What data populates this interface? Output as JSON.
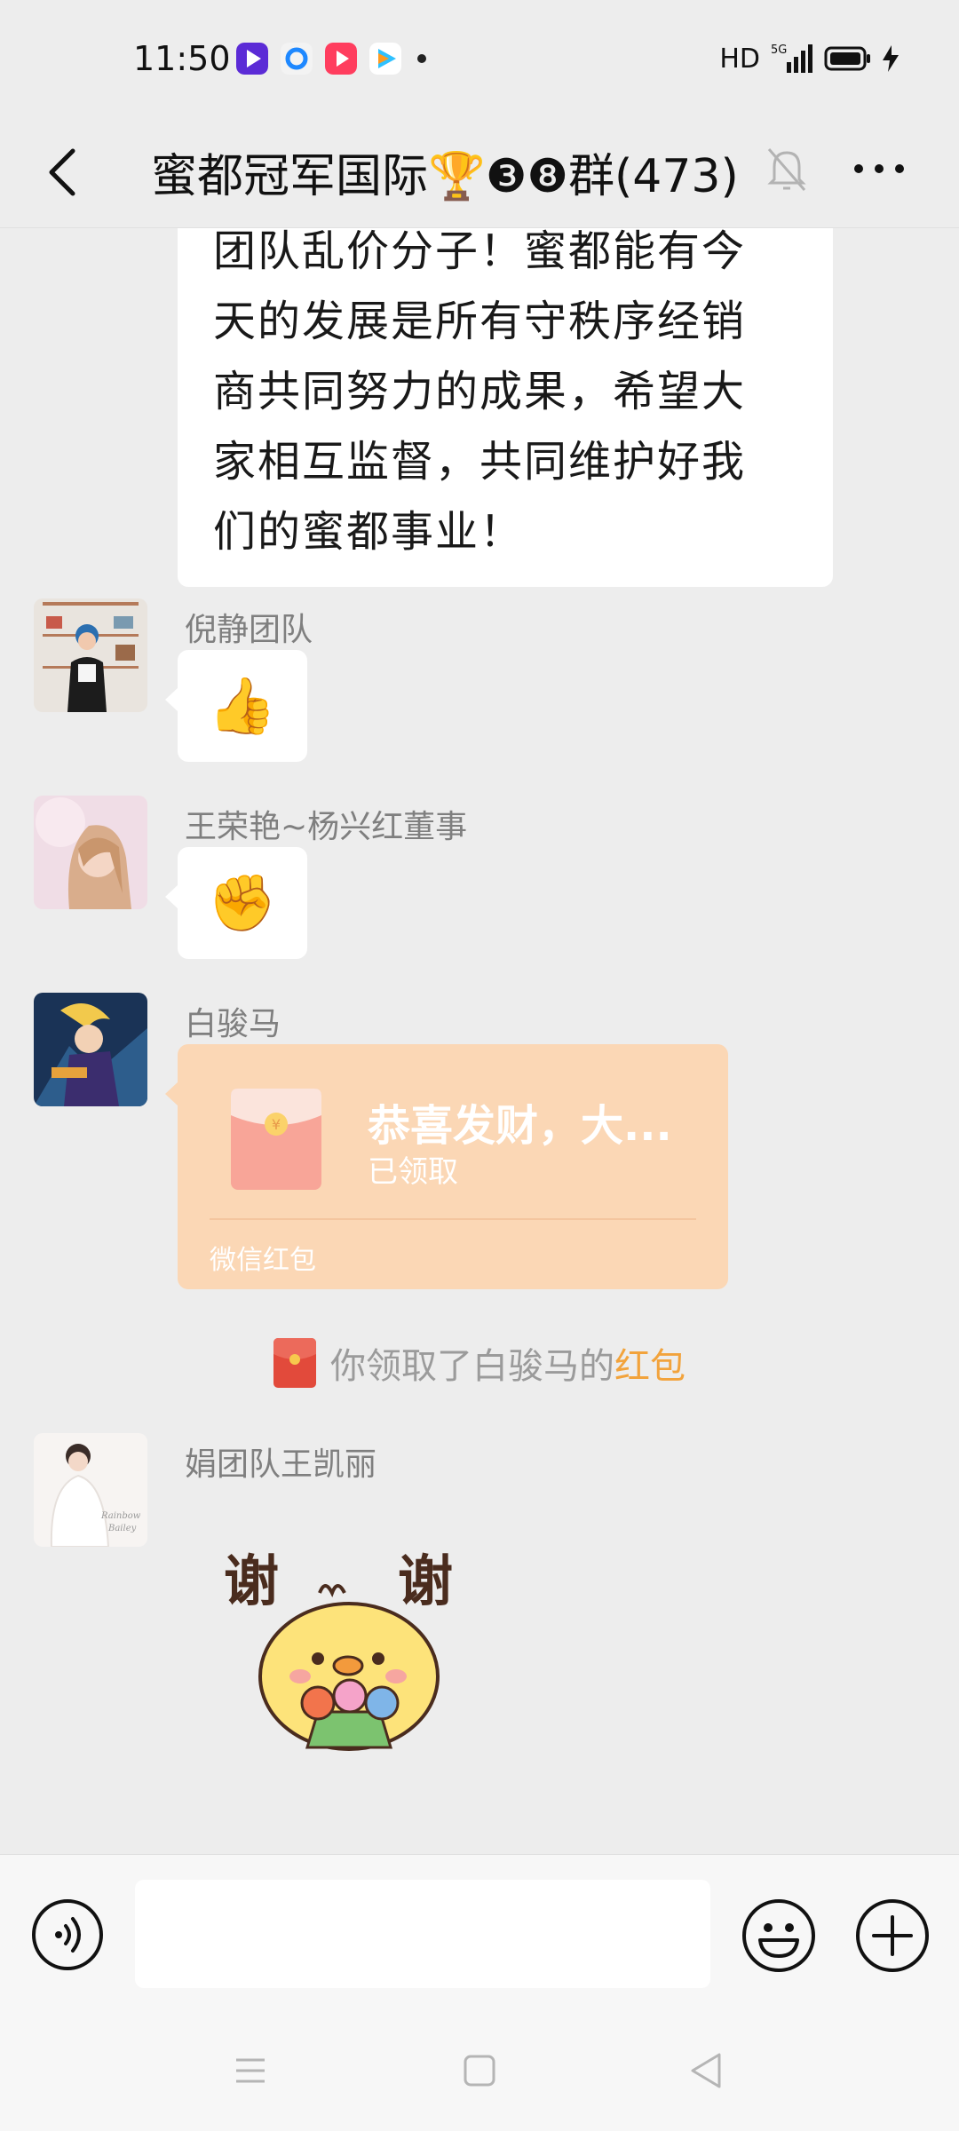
{
  "status_bar": {
    "time": "11:50",
    "network": "HD",
    "signal": "5G"
  },
  "header": {
    "title": "蜜都冠军国际🏆❸❽群(473)"
  },
  "long_message": {
    "lines": [
      "团队乱价分子！蜜都能有今",
      "天的发展是所有守秩序经销",
      "商共同努力的成果，希望大",
      "家相互监督，共同维护好我",
      "们的蜜都事业！"
    ]
  },
  "messages": [
    {
      "sender": "倪静团队",
      "emoji": "👍"
    },
    {
      "sender": "王荣艳~杨兴红董事",
      "emoji": "✊"
    }
  ],
  "red_packet": {
    "sender": "白骏马",
    "title": "恭喜发财，大...",
    "status": "已领取",
    "footer": "微信红包"
  },
  "system_notice": {
    "text": "你领取了白骏马的",
    "link": "红包"
  },
  "last_message": {
    "sender": "娟团队王凯丽",
    "sticker_text_left": "谢",
    "sticker_text_right": "谢"
  },
  "input": {
    "value": ""
  },
  "colors": {
    "background": "#ededed",
    "red_packet": "#fbd7b5",
    "link": "#f2a33c"
  }
}
